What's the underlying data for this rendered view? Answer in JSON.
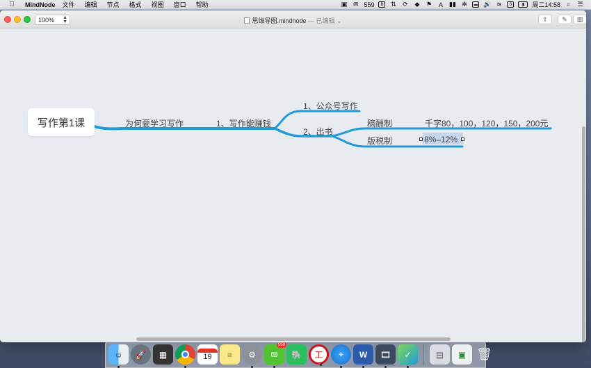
{
  "menubar": {
    "app_name": "MindNode",
    "items": [
      "文件",
      "编辑",
      "节点",
      "格式",
      "视图",
      "窗口",
      "帮助"
    ],
    "wechat_count": "559",
    "datetime": "周二14:58"
  },
  "window": {
    "zoom": "100%",
    "doc_name": "思维导图.mindnode",
    "doc_status": "— 已编辑"
  },
  "mindmap": {
    "root": "写作第1课",
    "nodes": {
      "why": "为何要学习写作",
      "earn": "1、写作能赚钱",
      "wechat": "1、公众号写作",
      "book": "2、出书",
      "royalty": "稿酬制",
      "royalty_value": "千字80，100，120，150，200元",
      "tax": "版税制",
      "tax_value": "8%–12%"
    },
    "branch_color": "#1f9bd8"
  },
  "dock": {
    "calendar_day": "19",
    "wechat_badge": "559",
    "items": [
      "finder",
      "launchpad",
      "photo-booth",
      "chrome",
      "calendar",
      "notes",
      "system-preferences",
      "wechat",
      "evernote",
      "bank",
      "safari",
      "word",
      "photo-slideshow",
      "mindnode",
      "preview",
      "documents",
      "trash"
    ]
  }
}
